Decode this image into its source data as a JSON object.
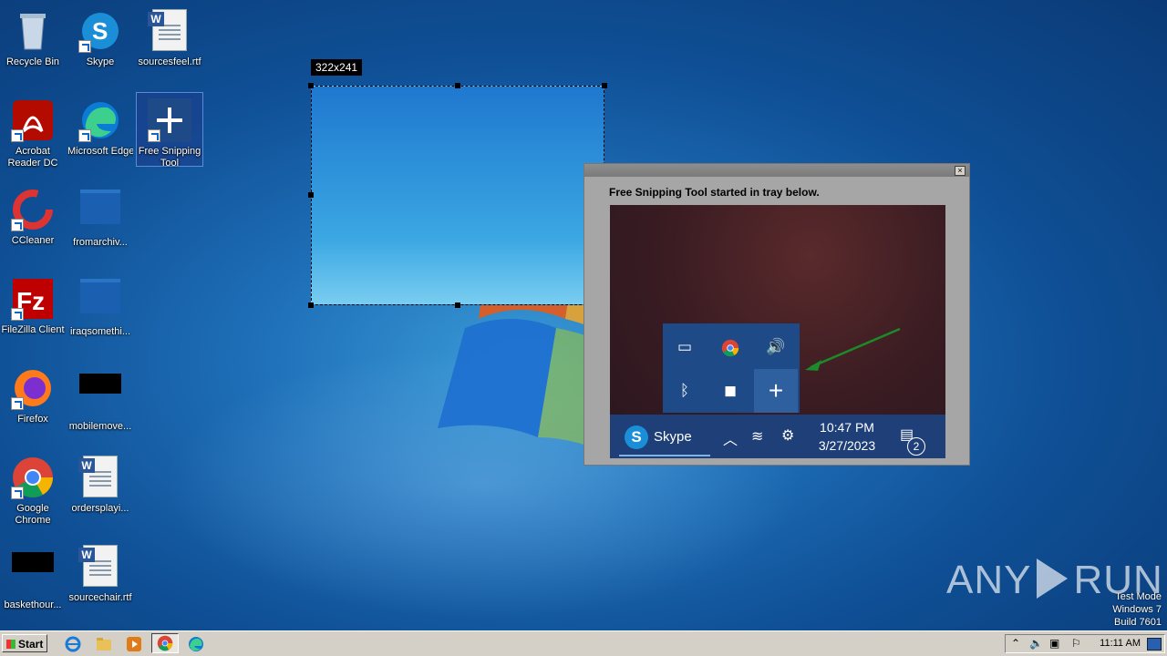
{
  "desktop_icons": [
    {
      "label": "Recycle Bin"
    },
    {
      "label": "Skype"
    },
    {
      "label": "sourcesfeel.rtf"
    },
    {
      "label": "Acrobat Reader DC"
    },
    {
      "label": "Microsoft Edge"
    },
    {
      "label": "Free Snipping Tool"
    },
    {
      "label": "CCleaner"
    },
    {
      "label": "fromarchiv..."
    },
    {
      "label": "FileZilla Client"
    },
    {
      "label": "iraqsomethi..."
    },
    {
      "label": "Firefox"
    },
    {
      "label": "mobilemove..."
    },
    {
      "label": "Google Chrome"
    },
    {
      "label": "ordersplayi..."
    },
    {
      "label": "baskethour..."
    },
    {
      "label": "sourcechair.rtf"
    }
  ],
  "selection": {
    "size_label": "322x241"
  },
  "popup": {
    "close_glyph": "×",
    "message": "Free Snipping Tool started in tray below.",
    "preview": {
      "taskbar_app": "Skype",
      "time": "10:47 PM",
      "date": "3/27/2023",
      "notification_count": "2"
    }
  },
  "watermark": {
    "brand_left": "ANY",
    "brand_right": "RUN"
  },
  "system_info": {
    "line1": "Test Mode",
    "line2": "Windows 7",
    "line3": "Build 7601"
  },
  "taskbar": {
    "start_label": "Start",
    "clock": "11:11 AM"
  },
  "colors": {
    "desktop_blue": "#1e6fb8",
    "taskbar_gray": "#d4d0c8",
    "tray_popup_blue": "#1e4b87"
  }
}
